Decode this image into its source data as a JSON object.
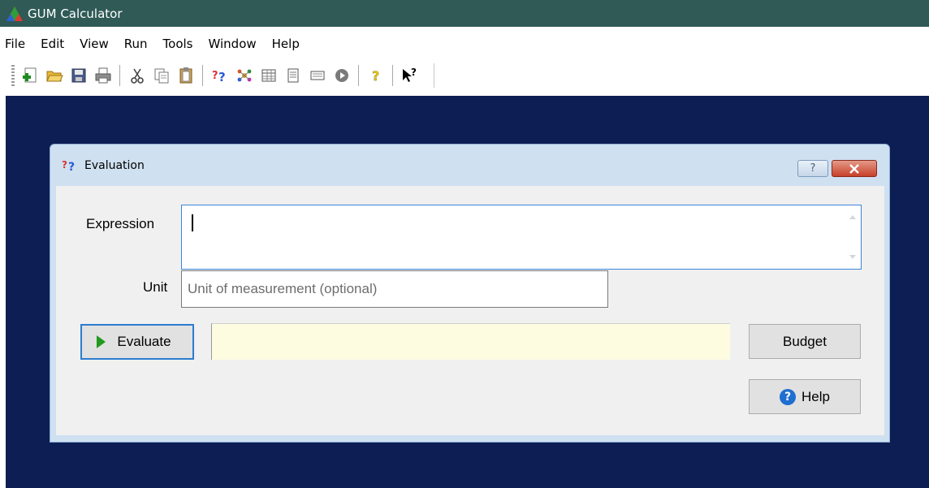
{
  "window": {
    "title": "GUM Calculator"
  },
  "menu": [
    "File",
    "Edit",
    "View",
    "Run",
    "Tools",
    "Window",
    "Help"
  ],
  "toolbar": {
    "buttons": [
      "new-icon",
      "open-icon",
      "save-icon",
      "print-icon",
      "cut-icon",
      "copy-icon",
      "paste-icon",
      "evaluation-icon",
      "model-icon",
      "table-icon",
      "document-icon",
      "panel-icon",
      "run-icon",
      "help-icon",
      "context-help-icon"
    ]
  },
  "dialog": {
    "title": "Evaluation",
    "help_glyph": "?",
    "expression_label": "Expression",
    "expression_value": "",
    "unit_label": "Unit",
    "unit_placeholder": "Unit of measurement (optional)",
    "evaluate_label": "Evaluate",
    "result_value": "",
    "budget_label": "Budget",
    "help_label": "Help",
    "help_circle_glyph": "?"
  },
  "colors": {
    "titlebar": "#2f5a56",
    "workspace": "#0d1e55",
    "result_background": "#fdfce1",
    "focus_border": "#2d7cd0"
  }
}
